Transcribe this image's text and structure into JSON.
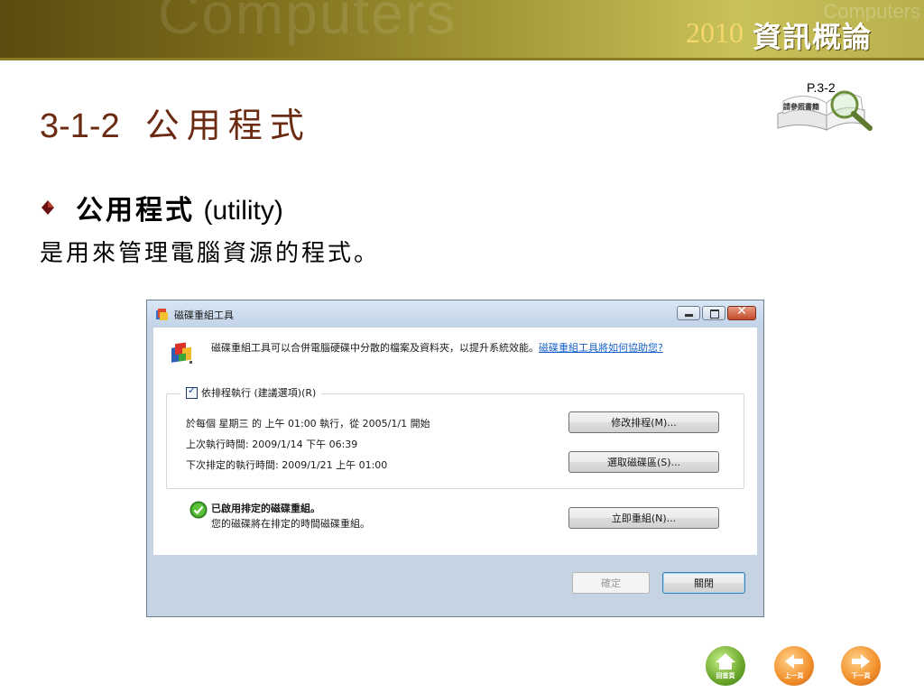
{
  "banner": {
    "watermark": "Computers",
    "watermark_small": "Computers",
    "year": "2010",
    "course": "資訊概論"
  },
  "slide": {
    "section": "3-1-2",
    "title": "公用程式",
    "page_ref": "P.3-2",
    "page_ref_note": "請參照書籍",
    "bullet_term": "公用程式",
    "bullet_term_en": "(utility)",
    "description": "是用來管理電腦資源的程式。"
  },
  "dialog": {
    "title": "磁碟重組工具",
    "intro_text": "磁碟重組工具可以合併電腦硬碟中分散的檔案及資料夾，以提升系統效能。",
    "intro_link": "磁碟重組工具將如何協助您?",
    "schedule_checkbox_label": "依排程執行 (建議選項)(R)",
    "schedule_checked": true,
    "schedule_line": "於每個 星期三 的 上午 01:00 執行，從 2005/1/1 開始",
    "last_run": "上次執行時間: 2009/1/14 下午 06:39",
    "next_run": "下次排定的執行時間: 2009/1/21 上午 01:00",
    "modify_schedule_button": "修改排程(M)...",
    "select_volumes_button": "選取磁碟區(S)...",
    "status_title": "已啟用排定的磁碟重組。",
    "status_sub": "您的磁碟將在排定的時間磁碟重組。",
    "defrag_now_button": "立即重組(N)...",
    "ok_button": "確定",
    "close_button": "關閉"
  },
  "nav": {
    "home": "回首頁",
    "prev": "上一頁",
    "next": "下一頁"
  },
  "colors": {
    "title": "#6b2a12",
    "link": "#1760c8",
    "dialog_frame": "#c6d3e3"
  }
}
